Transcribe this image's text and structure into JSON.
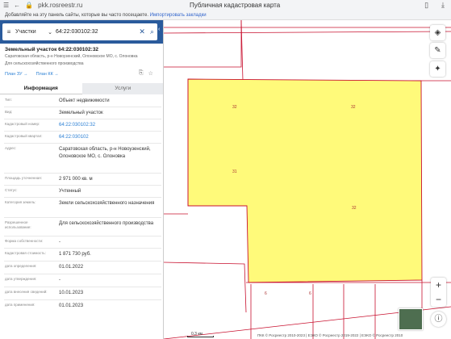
{
  "browser": {
    "url": "pkk.rosreestr.ru",
    "title": "Публичная кадастровая карта",
    "bookmark_hint": "Добавляйте на эту панель сайты, которые вы часто посещаете.",
    "bookmark_link": "Импортировать закладки"
  },
  "search": {
    "type_label": "Участки",
    "query": "64:22:030102:32"
  },
  "object": {
    "title": "Земельный участок 64:22:030102:32",
    "subtitle": "Саратовская область, р-н Новоузенский, Олоновское МО, с. Олоновка",
    "usage": "Для сельскохозяйственного производства",
    "plan_zu": "План ЗУ →",
    "plan_kk": "План КК →"
  },
  "tabs": [
    {
      "label": "Информация",
      "active": true
    },
    {
      "label": "Услуги",
      "active": false
    }
  ],
  "info_rows": [
    {
      "label": "Тип:",
      "value": "Объект недвижимости",
      "link": false
    },
    {
      "label": "Вид:",
      "value": "Земельный участок",
      "link": false
    },
    {
      "label": "Кадастровый номер:",
      "value": "64:22:030102:32",
      "link": true
    },
    {
      "label": "Кадастровый квартал:",
      "value": "64:22:030102",
      "link": true
    },
    {
      "label": "Адрес:",
      "value": "Саратовская область, р-н Новоузенский, Олоновское МО, с. Олоновка",
      "link": false
    },
    {
      "label": "Площадь уточненная:",
      "value": "2 971 000 кв. м",
      "link": false
    },
    {
      "label": "Статус:",
      "value": "Учтенный",
      "link": false
    },
    {
      "label": "Категория земель:",
      "value": "Земли сельскохозяйственного назначения",
      "link": false
    },
    {
      "label": "Разрешенное использование:",
      "value": "Для сельскохозяйственного производства",
      "link": false
    },
    {
      "label": "Форма собственности:",
      "value": "-",
      "link": false
    },
    {
      "label": "Кадастровая стоимость:",
      "value": "1 871 730 руб.",
      "link": false
    },
    {
      "label": "дата определения:",
      "value": "01.01.2022",
      "link": false
    },
    {
      "label": "дата утверждения:",
      "value": "-",
      "link": false
    },
    {
      "label": "дата внесения сведений:",
      "value": "10.01.2023",
      "link": false
    },
    {
      "label": "дата применения:",
      "value": "01.01.2023",
      "link": false
    }
  ],
  "map": {
    "parcel_labels": [
      "32",
      "32",
      "31",
      "32",
      "6",
      "6"
    ],
    "scale": "0,3 км",
    "attribution": "ПКК © Росреестр 2010-2023 | ЕЭКО © Росреестр 2019-2022 | ЕЭКО © Росреестр 2010",
    "parcel_fill": "#fffa7a",
    "boundary_color": "#c8102e",
    "accent": "#2a5b9c"
  }
}
